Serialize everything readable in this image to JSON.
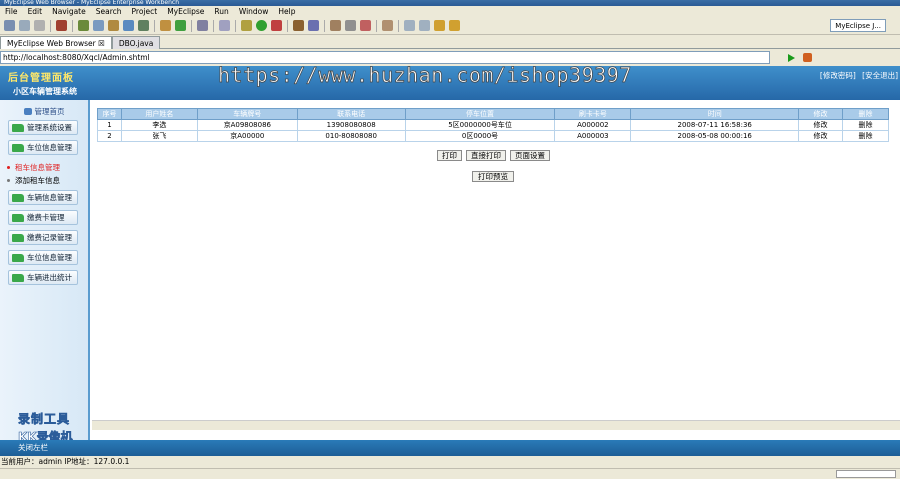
{
  "window": {
    "title": "MyEclipse Web Browser - MyEclipse Enterprise Workbench"
  },
  "menu": [
    "File",
    "Edit",
    "Navigate",
    "Search",
    "Project",
    "MyEclipse",
    "Run",
    "Window",
    "Help"
  ],
  "perspective": "MyEclipse J...",
  "tabs": [
    {
      "label": "MyEclipse Web Browser ☒"
    },
    {
      "label": "DBO.java"
    }
  ],
  "address": "http://localhost:8080/Xqcl/Admin.shtml",
  "header": {
    "logo": "后台管理面板",
    "app_name": "小区车辆管理系统",
    "link_password": "[修改密码]",
    "link_logout": "[安全退出]",
    "watermark": "https://www.huzhan.com/ishop39397"
  },
  "sidebar": {
    "top": "管理首页",
    "items": [
      "管理系统设置",
      "车位信息管理",
      "车辆信息管理",
      "缴费卡管理",
      "缴费记录管理",
      "车位信息管理",
      "车辆进出统计"
    ],
    "subitems": [
      {
        "label": "租车信息管理",
        "active": true
      },
      {
        "label": "添加租车信息",
        "active": false
      }
    ],
    "rec_watermark_1": "录制工具",
    "rec_watermark_2": "KK录像机"
  },
  "table": {
    "headers": [
      "序号",
      "用户姓名",
      "车辆牌号",
      "联系电话",
      "停车位置",
      "刷卡卡号",
      "时间",
      "修改",
      "删除"
    ],
    "rows": [
      [
        "1",
        "李选",
        "京A09808086",
        "13908080808",
        "5区0000000号车位",
        "A000002",
        "2008-07-11 16:58:36",
        "修改",
        "删除"
      ],
      [
        "2",
        "张飞",
        "京A00000",
        "010-80808080",
        "0区0000号",
        "A000003",
        "2008-05-08 00:00:16",
        "修改",
        "删除"
      ]
    ]
  },
  "buttons": {
    "print": "打印",
    "direct_print": "直接打印",
    "page_setup": "页面设置",
    "print_preview": "打印预览"
  },
  "footer": {
    "text": "关闭左栏",
    "user_info": "当前用户：admin  IP地址：127.0.0.1"
  }
}
